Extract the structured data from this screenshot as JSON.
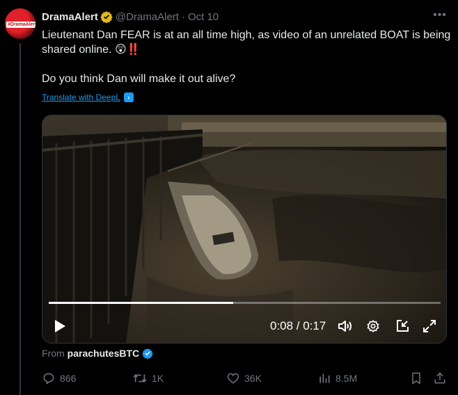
{
  "author": {
    "name": "DramaAlert",
    "handle": "@DramaAlert",
    "date": "Oct 10",
    "avatar_text": "#DramaAlert"
  },
  "tweet": {
    "line1": "Lieutenant Dan FEAR is at an all time high, as video of an unrelated BOAT is being shared online. 😲‼️",
    "line2": "Do you think Dan will make it out alive?",
    "translate": "Translate with DeepL"
  },
  "video": {
    "current_time": "0:08",
    "duration": "0:17",
    "time_display": "0:08 / 0:17",
    "progress": 0.47
  },
  "source": {
    "prefix": "From",
    "name": "parachutesBTC"
  },
  "actions": {
    "replies": "866",
    "reposts": "1K",
    "likes": "36K",
    "views": "8.5M"
  },
  "colors": {
    "accent": "#1d9bf0",
    "verified_gold": "#e2b719",
    "muted": "#71767b"
  },
  "icons": [
    "verified-gold-icon",
    "more-icon",
    "deepl-icon",
    "play-icon",
    "volume-icon",
    "settings-icon",
    "minimize-icon",
    "fullscreen-icon",
    "verified-blue-icon",
    "reply-icon",
    "repost-icon",
    "like-icon",
    "views-icon",
    "bookmark-icon",
    "share-icon"
  ]
}
